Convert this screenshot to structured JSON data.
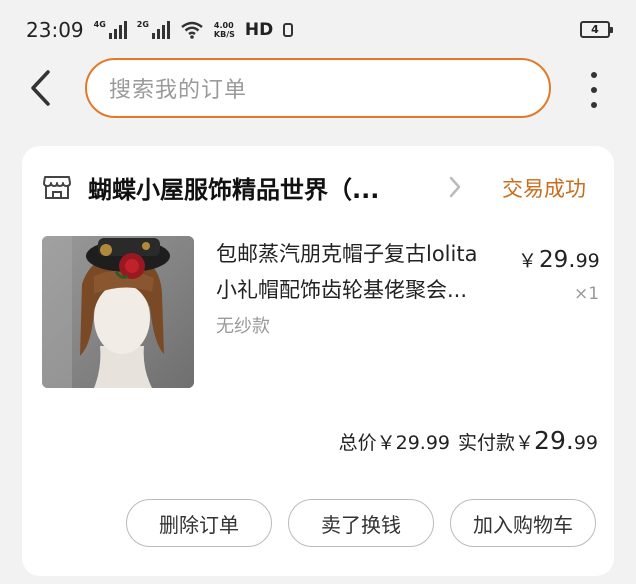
{
  "status_bar": {
    "time": "23:09",
    "net1": "4G",
    "net2": "2G",
    "speed_top": "4.00",
    "speed_bottom": "KB/S",
    "hd": "HD",
    "battery": "4"
  },
  "header": {
    "search_placeholder": "搜索我的订单",
    "accent": "#e07a2a"
  },
  "order": {
    "store_name": "蝴蝶小屋服饰精品世界（...",
    "status": "交易成功",
    "status_color": "#c96d1e",
    "item": {
      "title_line1": "包邮蒸汽朋克帽子复古lolita",
      "title_line2": "小礼帽配饰齿轮基佬聚会...",
      "variant": "无纱款",
      "price_symbol": "￥",
      "price_int": "29.",
      "price_dec": "99",
      "quantity": "×1"
    },
    "totals": {
      "total_label": "总价",
      "total_value": "￥29.99",
      "paid_label": "实付款",
      "paid_symbol": "￥",
      "paid_int": "29.",
      "paid_dec": "99"
    },
    "actions": {
      "delete": "删除订单",
      "sell": "卖了换钱",
      "add_cart": "加入购物车"
    }
  }
}
